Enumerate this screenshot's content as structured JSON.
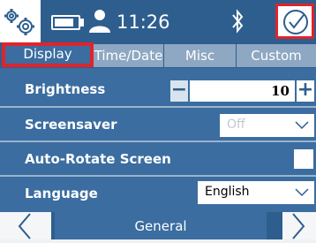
{
  "status": {
    "time": "11:26",
    "icons": [
      "gears-icon",
      "battery-icon",
      "user-icon",
      "bluetooth-icon",
      "check-circle-icon"
    ]
  },
  "tabs": [
    {
      "label": "Display",
      "active": true
    },
    {
      "label": "Time/Date",
      "active": false
    },
    {
      "label": "Misc",
      "active": false
    },
    {
      "label": "Custom",
      "active": false
    }
  ],
  "settings": {
    "brightness": {
      "label": "Brightness",
      "value": "10"
    },
    "screensaver": {
      "label": "Screensaver",
      "value": "Off"
    },
    "autorotate": {
      "label": "Auto-Rotate Screen",
      "checked": false
    },
    "language": {
      "label": "Language",
      "value": "English"
    }
  },
  "footer": {
    "title": "General"
  },
  "colors": {
    "accent": "#e0242b",
    "bar": "#2d5e8e",
    "panel": "#3b6da0"
  }
}
